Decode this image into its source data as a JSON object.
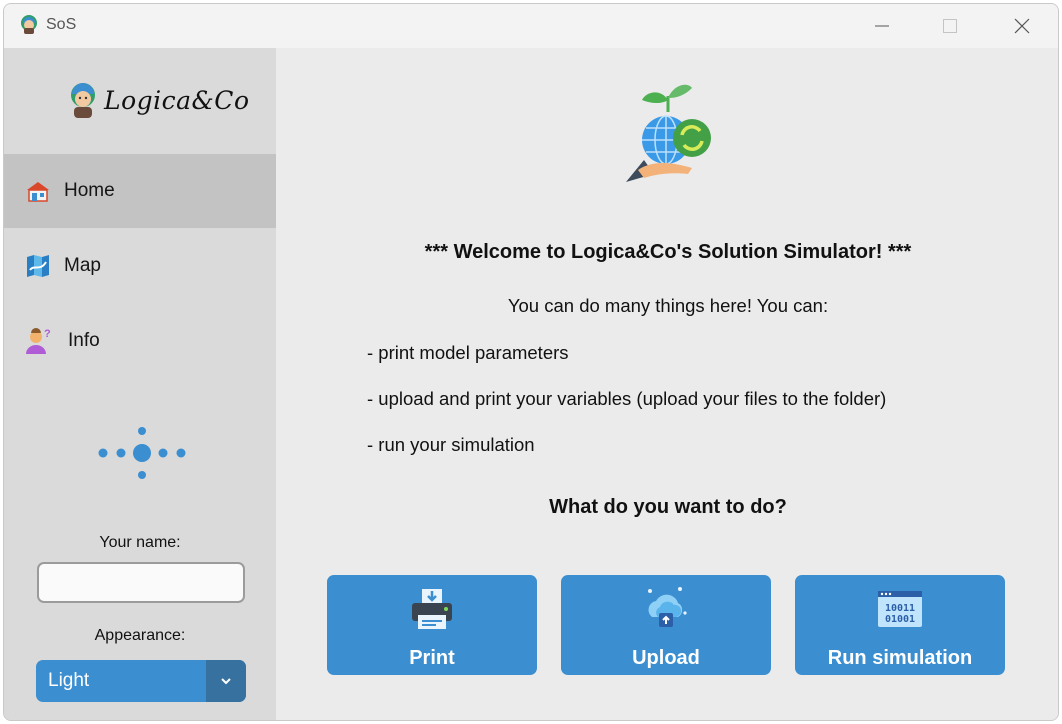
{
  "window": {
    "title": "SoS",
    "controls": {
      "minimize": "minimize",
      "maximize": "maximize",
      "close": "close"
    }
  },
  "sidebar": {
    "logo_text": "Logica&Co",
    "nav": [
      {
        "label": "Home",
        "icon": "house-icon",
        "active": true
      },
      {
        "label": "Map",
        "icon": "map-icon",
        "active": false
      },
      {
        "label": "Info",
        "icon": "person-question-icon",
        "active": false
      }
    ],
    "name_label": "Your name:",
    "name_value": "",
    "appearance_label": "Appearance:",
    "appearance_value": "Light"
  },
  "main": {
    "welcome": "*** Welcome to Logica&Co's Solution Simulator! ***",
    "intro": "You can do many things here! You can:",
    "bullets": [
      "- print model parameters",
      "- upload and print your variables (upload your files to the folder)",
      "- run your simulation"
    ],
    "question": "What do you want to do?",
    "buttons": {
      "print": "Print",
      "upload": "Upload",
      "run": "Run simulation"
    },
    "run_icon_text": [
      "10011",
      "01001"
    ]
  },
  "colors": {
    "accent": "#3b8ed0",
    "accent_dark": "#36719f",
    "sidebar_bg": "#dadada",
    "active_nav_bg": "#c3c3c3",
    "main_bg": "#ebebeb"
  }
}
